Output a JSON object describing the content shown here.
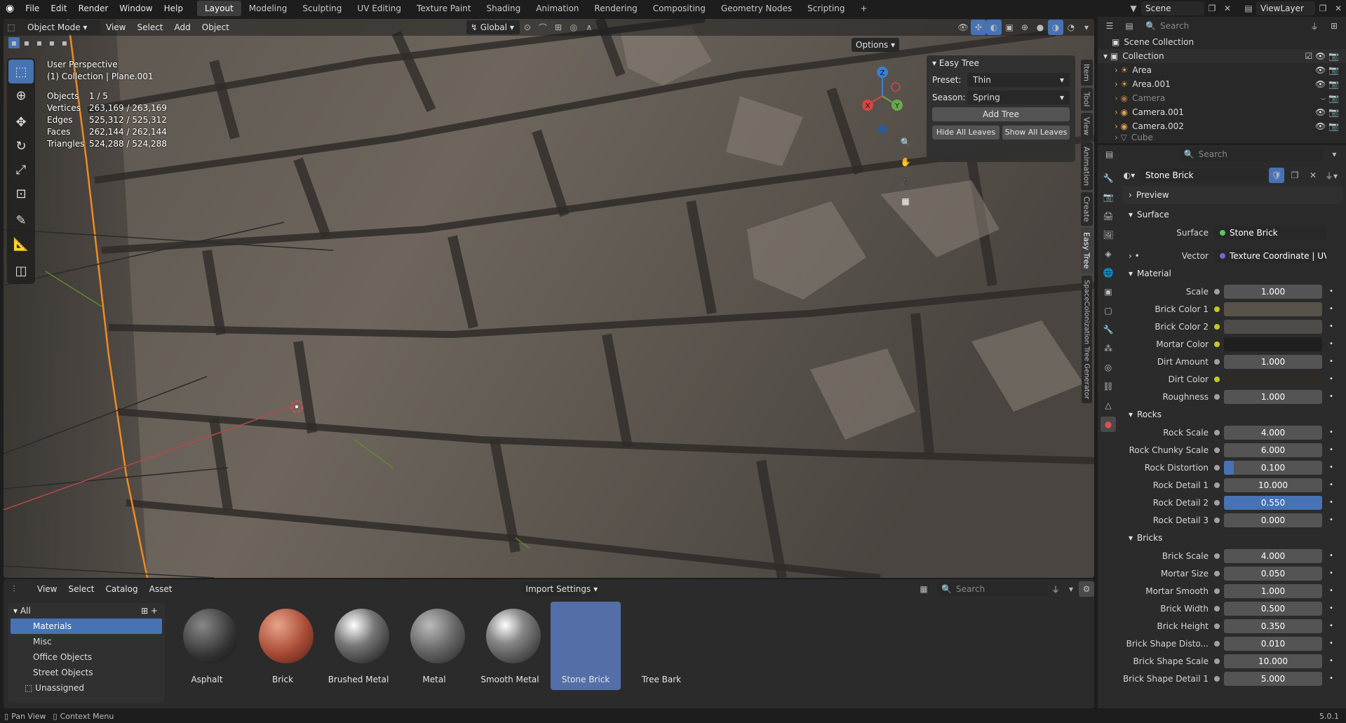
{
  "topbar": {
    "menus": [
      "File",
      "Edit",
      "Render",
      "Window",
      "Help"
    ],
    "workspaces": [
      "Layout",
      "Modeling",
      "Sculpting",
      "UV Editing",
      "Texture Paint",
      "Shading",
      "Animation",
      "Rendering",
      "Compositing",
      "Geometry Nodes",
      "Scripting"
    ],
    "active_workspace": "Layout",
    "scene": "Scene",
    "view_layer": "ViewLayer"
  },
  "viewport_header": {
    "mode": "Object Mode",
    "menus": [
      "View",
      "Select",
      "Add",
      "Object"
    ],
    "transform_orientation": "Global",
    "options": "Options"
  },
  "viewport": {
    "perspective": "User Perspective",
    "collection": "(1) Collection | Plane.001",
    "stats": [
      {
        "label": "Objects",
        "value": "1 / 5"
      },
      {
        "label": "Vertices",
        "value": "263,169 / 263,169"
      },
      {
        "label": "Edges",
        "value": "525,312 / 525,312"
      },
      {
        "label": "Faces",
        "value": "262,144 / 262,144"
      },
      {
        "label": "Triangles",
        "value": "524,288 / 524,288"
      }
    ],
    "gizmo": {
      "x": "X",
      "y": "Y",
      "z": "Z"
    }
  },
  "easy_tree": {
    "title": "Easy Tree",
    "preset_label": "Preset:",
    "preset_value": "Thin",
    "season_label": "Season:",
    "season_value": "Spring",
    "add_tree": "Add Tree",
    "hide_leaves": "Hide All Leaves",
    "show_leaves": "Show All Leaves"
  },
  "sidebar_tabs": [
    "Item",
    "Tool",
    "View",
    "Animation",
    "Create",
    "Easy Tree",
    "SpaceColonization Tree Generator"
  ],
  "sidebar_active": "Easy Tree",
  "outliner": {
    "search_placeholder": "Search",
    "scene_collection": "Scene Collection",
    "collection": "Collection",
    "items": [
      "Area",
      "Area.001",
      "Camera",
      "Camera.001",
      "Camera.002",
      "Cube"
    ]
  },
  "properties": {
    "search_placeholder": "Search",
    "material_name": "Stone Brick",
    "preview": "Preview",
    "surface_section": "Surface",
    "surface_label": "Surface",
    "surface_value": "Stone Brick",
    "vector_label": "Vector",
    "vector_value": "Texture Coordinate | UV",
    "material_section": "Material",
    "material_rows": [
      {
        "label": "Scale",
        "value": "1.000"
      },
      {
        "label": "Brick Color 1",
        "value": ""
      },
      {
        "label": "Brick Color 2",
        "value": ""
      },
      {
        "label": "Mortar Color",
        "value": ""
      },
      {
        "label": "Dirt Amount",
        "value": "1.000"
      },
      {
        "label": "Dirt Color",
        "value": ""
      },
      {
        "label": "Roughness",
        "value": "1.000"
      }
    ],
    "rocks_section": "Rocks",
    "rocks_rows": [
      {
        "label": "Rock Scale",
        "value": "4.000"
      },
      {
        "label": "Rock Chunky Scale",
        "value": "6.000"
      },
      {
        "label": "Rock Distortion",
        "value": "0.100",
        "fill": 0.1
      },
      {
        "label": "Rock Detail 1",
        "value": "10.000"
      },
      {
        "label": "Rock Detail 2",
        "value": "0.550",
        "fill": 1.0
      },
      {
        "label": "Rock Detail 3",
        "value": "0.000"
      }
    ],
    "bricks_section": "Bricks",
    "bricks_rows": [
      {
        "label": "Brick Scale",
        "value": "4.000"
      },
      {
        "label": "Mortar Size",
        "value": "0.050"
      },
      {
        "label": "Mortar Smooth",
        "value": "1.000"
      },
      {
        "label": "Brick Width",
        "value": "0.500"
      },
      {
        "label": "Brick Height",
        "value": "0.350"
      },
      {
        "label": "Brick Shape Disto...",
        "value": "0.010"
      },
      {
        "label": "Brick Shape Scale",
        "value": "10.000"
      },
      {
        "label": "Brick Shape Detail 1",
        "value": "5.000"
      }
    ]
  },
  "asset_browser": {
    "menus": [
      "View",
      "Select",
      "Catalog",
      "Asset"
    ],
    "import_settings": "Import Settings",
    "search_placeholder": "Search",
    "tree_root": "All",
    "catalogs": [
      "Materials",
      "Misc",
      "Office Objects",
      "Street Objects",
      "Unassigned"
    ],
    "active_catalog": "Materials",
    "assets": [
      "Asphalt",
      "Brick",
      "Brushed Metal",
      "Metal",
      "Smooth Metal",
      "Stone Brick",
      "Tree Bark"
    ],
    "selected_asset": "Stone Brick"
  },
  "statusbar": {
    "pan_view": "Pan View",
    "context_menu": "Context Menu",
    "version": "5.0.1"
  }
}
